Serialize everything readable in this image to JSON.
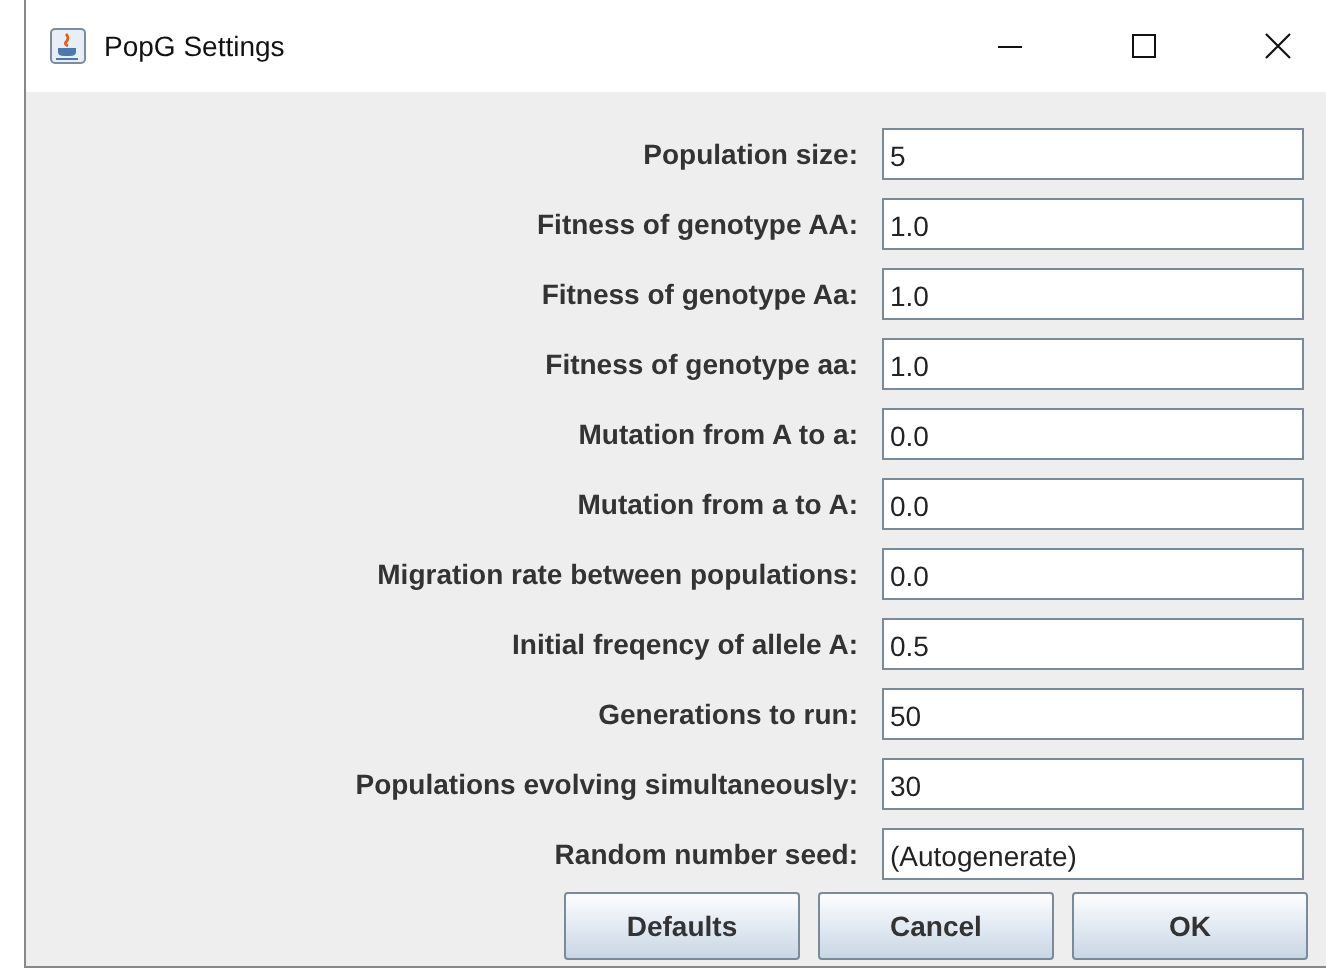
{
  "window": {
    "title": "PopG Settings"
  },
  "fields": [
    {
      "label": "Population size:",
      "value": "5"
    },
    {
      "label": "Fitness of genotype AA:",
      "value": "1.0"
    },
    {
      "label": "Fitness of genotype Aa:",
      "value": "1.0"
    },
    {
      "label": "Fitness of genotype aa:",
      "value": "1.0"
    },
    {
      "label": "Mutation from A to a:",
      "value": "0.0"
    },
    {
      "label": "Mutation from a to A:",
      "value": "0.0"
    },
    {
      "label": "Migration rate between populations:",
      "value": "0.0"
    },
    {
      "label": "Initial freqency of allele A:",
      "value": "0.5"
    },
    {
      "label": "Generations to run:",
      "value": "50"
    },
    {
      "label": "Populations evolving simultaneously:",
      "value": "30"
    },
    {
      "label": "Random number seed:",
      "value": "(Autogenerate)"
    }
  ],
  "buttons": [
    "Defaults",
    "Cancel",
    "OK"
  ]
}
